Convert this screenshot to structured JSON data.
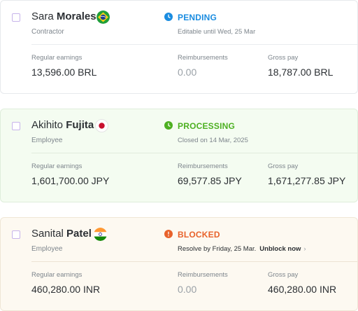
{
  "colors": {
    "pending": "#1a8ce0",
    "processing": "#4db021",
    "blocked": "#e8622b",
    "checkbox_border": "#c7b4ea"
  },
  "rows": [
    {
      "first_name": "Sara",
      "last_name": "Morales",
      "flag": "brazil-flag-icon",
      "role": "Contractor",
      "status_icon": "clock-icon",
      "status": "PENDING",
      "status_sub": "Editable until Wed, 25 Mar",
      "regular_label": "Regular earnings",
      "regular_value": "13,596.00 BRL",
      "reimb_label": "Reimbursements",
      "reimb_value": "0.00",
      "gross_label": "Gross pay",
      "gross_value": "18,787.00 BRL"
    },
    {
      "first_name": "Akihito",
      "last_name": "Fujita",
      "flag": "japan-flag-icon",
      "role": "Employee",
      "status_icon": "clock-icon",
      "status": "PROCESSING",
      "status_sub": "Closed on 14 Mar, 2025",
      "regular_label": "Regular earnings",
      "regular_value": "1,601,700.00 JPY",
      "reimb_label": "Reimbursements",
      "reimb_value": "69,577.85 JPY",
      "gross_label": "Gross pay",
      "gross_value": "1,671,277.85 JPY"
    },
    {
      "first_name": "Sanital",
      "last_name": "Patel",
      "flag": "india-flag-icon",
      "role": "Employee",
      "status_icon": "alert-icon",
      "status": "BLOCKED",
      "status_sub": "Resolve by Friday, 25 Mar.",
      "action_label": "Unblock now",
      "regular_label": "Regular earnings",
      "regular_value": "460,280.00 INR",
      "reimb_label": "Reimbursements",
      "reimb_value": "0.00",
      "gross_label": "Gross pay",
      "gross_value": "460,280.00 INR"
    }
  ]
}
